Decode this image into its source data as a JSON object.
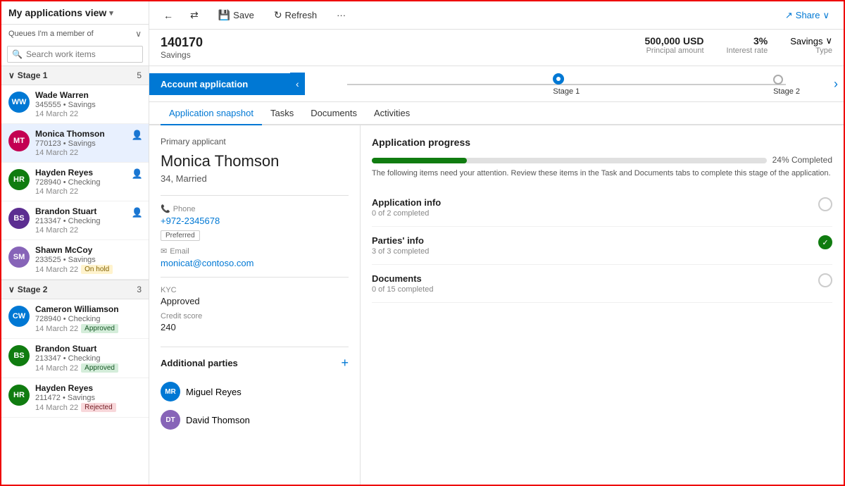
{
  "sidebar": {
    "title": "My applications view",
    "queues_label": "Queues I'm a member of",
    "search_placeholder": "Search work items",
    "stage1": {
      "label": "Stage 1",
      "count": "5",
      "items": [
        {
          "initials": "WW",
          "name": "Wade Warren",
          "id": "345555",
          "type": "Savings",
          "date": "14 March 22",
          "color": "#0078d4",
          "badge": null,
          "has_person": false
        },
        {
          "initials": "MT",
          "name": "Monica Thomson",
          "id": "770123",
          "type": "Savings",
          "date": "14 March 22",
          "color": "#c30052",
          "badge": null,
          "has_person": true,
          "active": true
        },
        {
          "initials": "HR",
          "name": "Hayden Reyes",
          "id": "728940",
          "type": "Checking",
          "date": "14 March 22",
          "color": "#107c10",
          "badge": null,
          "has_person": true
        },
        {
          "initials": "BS",
          "name": "Brandon Stuart",
          "id": "213347",
          "type": "Checking",
          "date": "14 March 22",
          "color": "#5c2e91",
          "badge": null,
          "has_person": true
        },
        {
          "initials": "SM",
          "name": "Shawn McCoy",
          "id": "233525",
          "type": "Savings",
          "date": "14 March 22",
          "color": "#8764b8",
          "badge": "On hold",
          "badge_type": "onhold",
          "has_person": false
        }
      ]
    },
    "stage2": {
      "label": "Stage 2",
      "count": "3",
      "items": [
        {
          "initials": "CW",
          "name": "Cameron Williamson",
          "id": "728940",
          "type": "Checking",
          "date": "14 March 22",
          "color": "#0078d4",
          "badge": "Approved",
          "badge_type": "approved",
          "has_person": false
        },
        {
          "initials": "BS",
          "name": "Brandon Stuart",
          "id": "213347",
          "type": "Checking",
          "date": "14 March 22",
          "color": "#107c10",
          "badge": "Approved",
          "badge_type": "approved",
          "has_person": false
        },
        {
          "initials": "HR",
          "name": "Hayden Reyes",
          "id": "211472",
          "type": "Savings",
          "date": "14 March 22",
          "color": "#107c10",
          "badge": "Rejected",
          "badge_type": "rejected",
          "has_person": false
        }
      ]
    }
  },
  "topbar": {
    "save_label": "Save",
    "refresh_label": "Refresh",
    "share_label": "Share"
  },
  "record": {
    "id": "140170",
    "type": "Savings",
    "principal_amount": "500,000 USD",
    "principal_label": "Principal amount",
    "interest_rate": "3%",
    "interest_label": "Interest rate",
    "savings_type": "Savings",
    "savings_label": "Type"
  },
  "stage_bar": {
    "active_label": "Account application",
    "stage1_label": "Stage 1",
    "stage2_label": "Stage 2"
  },
  "tabs": {
    "items": [
      {
        "label": "Application snapshot",
        "active": true
      },
      {
        "label": "Tasks",
        "active": false
      },
      {
        "label": "Documents",
        "active": false
      },
      {
        "label": "Activities",
        "active": false
      }
    ]
  },
  "primary_applicant": {
    "section_label": "Primary applicant",
    "name": "Monica Thomson",
    "details": "34, Married",
    "phone_label": "Phone",
    "phone": "+972-2345678",
    "preferred_badge": "Preferred",
    "email_label": "Email",
    "email": "monicat@contoso.com",
    "kyc_label": "KYC",
    "kyc_value": "Approved",
    "credit_label": "Credit score",
    "credit_value": "240"
  },
  "additional_parties": {
    "title": "Additional parties",
    "add_btn": "+",
    "items": [
      {
        "initials": "MR",
        "name": "Miguel Reyes",
        "color": "#0078d4"
      },
      {
        "initials": "DT",
        "name": "David Thomson",
        "color": "#8764b8"
      }
    ]
  },
  "application_progress": {
    "title": "Application progress",
    "percent": 24,
    "percent_label": "24% Completed",
    "note": "The following items need your attention. Review these items in the Task and Documents tabs to complete this stage of the application.",
    "checklist": [
      {
        "title": "Application info",
        "sub": "0 of 2 completed",
        "done": false
      },
      {
        "title": "Parties' info",
        "sub": "3 of 3 completed",
        "done": true
      },
      {
        "title": "Documents",
        "sub": "0 of 15 completed",
        "done": false
      }
    ]
  }
}
